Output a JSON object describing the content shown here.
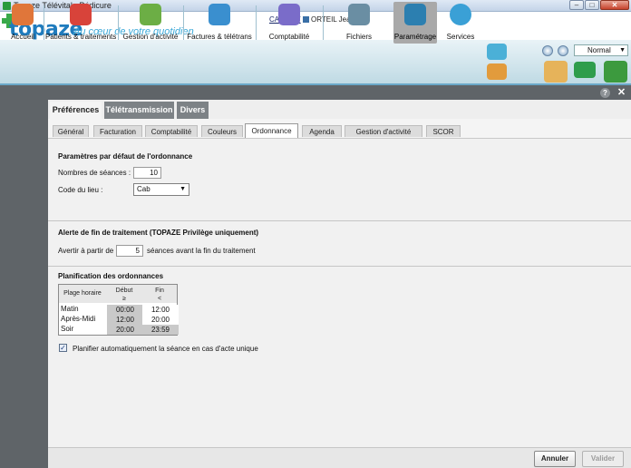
{
  "window": {
    "title": "Topaze Télévitale Pédicure",
    "min_glyph": "–",
    "max_glyph": "□",
    "close_glyph": "✕"
  },
  "header": {
    "logo": "topaze",
    "tagline": "Au cœur de votre quotidien",
    "cabinet_label": "CABINET",
    "user_name": "ORTEIL Jean"
  },
  "toolbar": {
    "items": [
      {
        "label": "Accueil",
        "icon": "house-icon",
        "color": "#e0763a"
      },
      {
        "label": "Patients & traitements",
        "icon": "patients-icon",
        "color": "#d8433a"
      },
      {
        "label": "Gestion d'activité",
        "icon": "activity-icon",
        "color": "#6cae45"
      },
      {
        "label": "Factures & télétrans",
        "icon": "invoices-icon",
        "color": "#3a8fcf"
      },
      {
        "label": "Comptabilité",
        "icon": "accounting-icon",
        "color": "#7a6cc9"
      },
      {
        "label": "Fichiers",
        "icon": "files-icon",
        "color": "#6a8ea3"
      },
      {
        "label": "Paramétrage",
        "icon": "settings-gears-icon",
        "color": "#2c7fb0"
      },
      {
        "label": "Services",
        "icon": "globe-icon",
        "color": "#3aa0d6"
      }
    ],
    "zoom_select": "Normal"
  },
  "tabs": {
    "top": [
      "Préférences",
      "Télétransmission",
      "Divers"
    ],
    "sub": [
      "Général",
      "Facturation",
      "Comptabilité",
      "Couleurs",
      "Ordonnance",
      "Agenda",
      "Gestion d'activité",
      "SCOR"
    ]
  },
  "ordonnance": {
    "title": "Paramètres par défaut de l'ordonnance",
    "seances_label": "Nombres de séances :",
    "seances_value": "10",
    "lieu_label": "Code du lieu :",
    "lieu_value": "Cab"
  },
  "alerte": {
    "title": "Alerte de fin de traitement (TOPAZE Privilège uniquement)",
    "prefix": "Avertir à partir de",
    "value": "5",
    "suffix": "séances avant la fin du traitement"
  },
  "planification": {
    "title": "Planification des ordonnances",
    "col_range": "Plage horaire",
    "col_debut": "Début",
    "col_debut_op": "≥",
    "col_fin": "Fin",
    "col_fin_op": "<",
    "rows": [
      {
        "name": "Matin",
        "debut": "00:00",
        "fin": "12:00"
      },
      {
        "name": "Après-Midi",
        "debut": "12:00",
        "fin": "20:00"
      },
      {
        "name": "Soir",
        "debut": "20:00",
        "fin": "23:59"
      }
    ],
    "auto_label": "Planifier automatiquement la séance en cas d'acte unique",
    "auto_checked": true
  },
  "footer": {
    "cancel": "Annuler",
    "validate": "Valider"
  }
}
